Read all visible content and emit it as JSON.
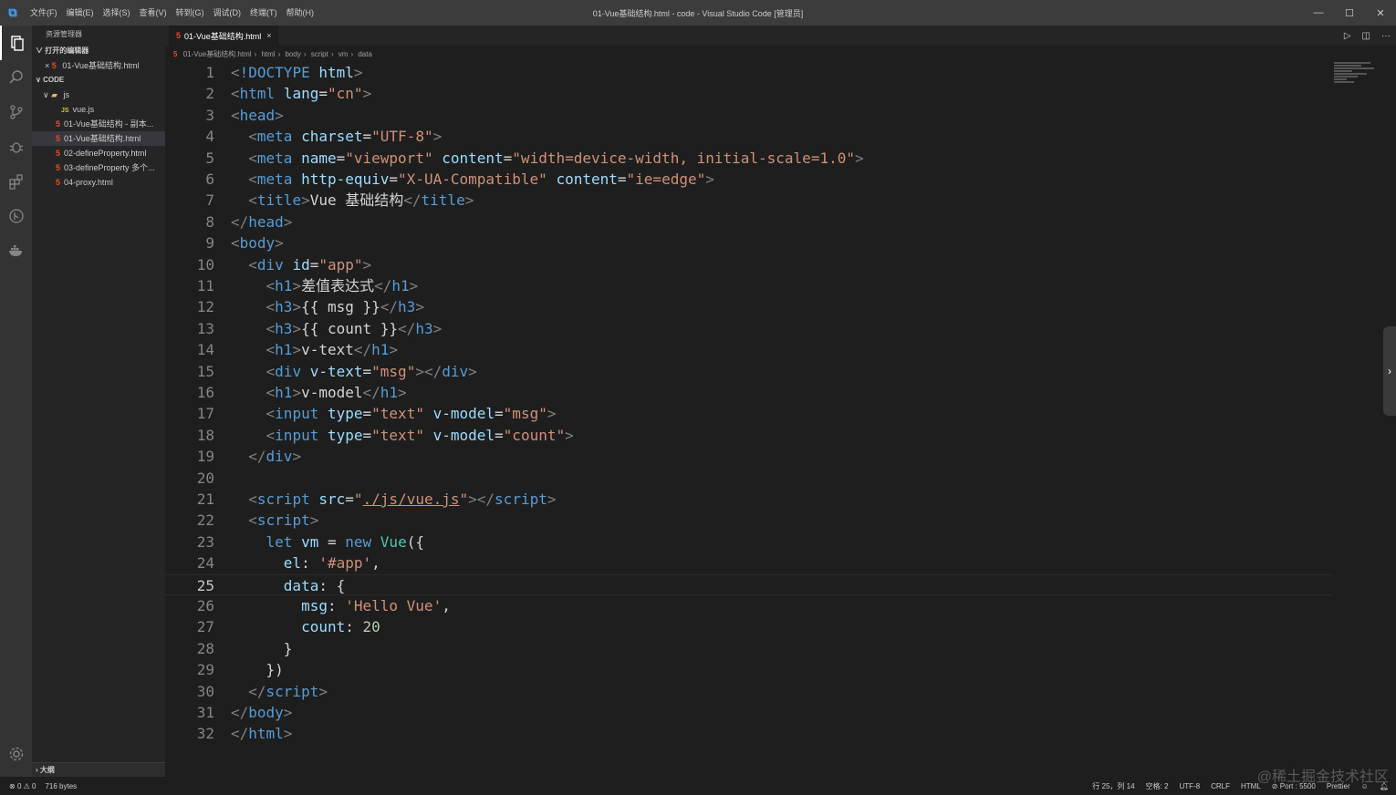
{
  "titlebar": {
    "menu": [
      "文件(F)",
      "编辑(E)",
      "选择(S)",
      "查看(V)",
      "转到(G)",
      "调试(D)",
      "终端(T)",
      "帮助(H)"
    ],
    "title": "01-Vue基础结构.html - code - Visual Studio Code [管理员]"
  },
  "sidebar": {
    "title": "资源管理器",
    "open_editors_label": "打开的编辑器",
    "open_editor_file": "01-Vue基础结构.html",
    "workspace_label": "CODE",
    "folder": "js",
    "files": [
      {
        "name": "vue.js",
        "type": "js",
        "indent": 2
      },
      {
        "name": "01-Vue基础结构 - 副本...",
        "type": "html",
        "indent": 1
      },
      {
        "name": "01-Vue基础结构.html",
        "type": "html",
        "indent": 1,
        "selected": true
      },
      {
        "name": "02-defineProperty.html",
        "type": "html",
        "indent": 1
      },
      {
        "name": "03-defineProperty 多个...",
        "type": "html",
        "indent": 1
      },
      {
        "name": "04-proxy.html",
        "type": "html",
        "indent": 1
      }
    ],
    "outline_label": "大纲"
  },
  "tab": {
    "label": "01-Vue基础结构.html",
    "close": "×"
  },
  "breadcrumb": [
    "01-Vue基础结构.html",
    "html",
    "body",
    "script",
    "vm",
    "data"
  ],
  "editor": {
    "current_line": 25,
    "lines": [
      [
        [
          "t-br",
          "<"
        ],
        [
          "t-tag",
          "!DOCTYPE"
        ],
        [
          "t-text",
          " "
        ],
        [
          "t-attr",
          "html"
        ],
        [
          "t-br",
          ">"
        ]
      ],
      [
        [
          "t-br",
          "<"
        ],
        [
          "t-tag",
          "html"
        ],
        [
          "t-text",
          " "
        ],
        [
          "t-attr",
          "lang"
        ],
        [
          "t-text",
          "="
        ],
        [
          "t-str",
          "\"cn\""
        ],
        [
          "t-br",
          ">"
        ]
      ],
      [
        [
          "t-br",
          "<"
        ],
        [
          "t-tag",
          "head"
        ],
        [
          "t-br",
          ">"
        ]
      ],
      [
        [
          "t-text",
          "  "
        ],
        [
          "t-br",
          "<"
        ],
        [
          "t-tag",
          "meta"
        ],
        [
          "t-text",
          " "
        ],
        [
          "t-attr",
          "charset"
        ],
        [
          "t-text",
          "="
        ],
        [
          "t-str",
          "\"UTF-8\""
        ],
        [
          "t-br",
          ">"
        ]
      ],
      [
        [
          "t-text",
          "  "
        ],
        [
          "t-br",
          "<"
        ],
        [
          "t-tag",
          "meta"
        ],
        [
          "t-text",
          " "
        ],
        [
          "t-attr",
          "name"
        ],
        [
          "t-text",
          "="
        ],
        [
          "t-str",
          "\"viewport\""
        ],
        [
          "t-text",
          " "
        ],
        [
          "t-attr",
          "content"
        ],
        [
          "t-text",
          "="
        ],
        [
          "t-str",
          "\"width=device-width, initial-scale=1.0\""
        ],
        [
          "t-br",
          ">"
        ]
      ],
      [
        [
          "t-text",
          "  "
        ],
        [
          "t-br",
          "<"
        ],
        [
          "t-tag",
          "meta"
        ],
        [
          "t-text",
          " "
        ],
        [
          "t-attr",
          "http-equiv"
        ],
        [
          "t-text",
          "="
        ],
        [
          "t-str",
          "\"X-UA-Compatible\""
        ],
        [
          "t-text",
          " "
        ],
        [
          "t-attr",
          "content"
        ],
        [
          "t-text",
          "="
        ],
        [
          "t-str",
          "\"ie=edge\""
        ],
        [
          "t-br",
          ">"
        ]
      ],
      [
        [
          "t-text",
          "  "
        ],
        [
          "t-br",
          "<"
        ],
        [
          "t-tag",
          "title"
        ],
        [
          "t-br",
          ">"
        ],
        [
          "t-text",
          "Vue 基础结构"
        ],
        [
          "t-br",
          "</"
        ],
        [
          "t-tag",
          "title"
        ],
        [
          "t-br",
          ">"
        ]
      ],
      [
        [
          "t-br",
          "</"
        ],
        [
          "t-tag",
          "head"
        ],
        [
          "t-br",
          ">"
        ]
      ],
      [
        [
          "t-br",
          "<"
        ],
        [
          "t-tag",
          "body"
        ],
        [
          "t-br",
          ">"
        ]
      ],
      [
        [
          "t-text",
          "  "
        ],
        [
          "t-br",
          "<"
        ],
        [
          "t-tag",
          "div"
        ],
        [
          "t-text",
          " "
        ],
        [
          "t-attr",
          "id"
        ],
        [
          "t-text",
          "="
        ],
        [
          "t-str",
          "\"app\""
        ],
        [
          "t-br",
          ">"
        ]
      ],
      [
        [
          "t-text",
          "    "
        ],
        [
          "t-br",
          "<"
        ],
        [
          "t-tag",
          "h1"
        ],
        [
          "t-br",
          ">"
        ],
        [
          "t-text",
          "差值表达式"
        ],
        [
          "t-br",
          "</"
        ],
        [
          "t-tag",
          "h1"
        ],
        [
          "t-br",
          ">"
        ]
      ],
      [
        [
          "t-text",
          "    "
        ],
        [
          "t-br",
          "<"
        ],
        [
          "t-tag",
          "h3"
        ],
        [
          "t-br",
          ">"
        ],
        [
          "t-text",
          "{{ msg }}"
        ],
        [
          "t-br",
          "</"
        ],
        [
          "t-tag",
          "h3"
        ],
        [
          "t-br",
          ">"
        ]
      ],
      [
        [
          "t-text",
          "    "
        ],
        [
          "t-br",
          "<"
        ],
        [
          "t-tag",
          "h3"
        ],
        [
          "t-br",
          ">"
        ],
        [
          "t-text",
          "{{ count }}"
        ],
        [
          "t-br",
          "</"
        ],
        [
          "t-tag",
          "h3"
        ],
        [
          "t-br",
          ">"
        ]
      ],
      [
        [
          "t-text",
          "    "
        ],
        [
          "t-br",
          "<"
        ],
        [
          "t-tag",
          "h1"
        ],
        [
          "t-br",
          ">"
        ],
        [
          "t-text",
          "v-text"
        ],
        [
          "t-br",
          "</"
        ],
        [
          "t-tag",
          "h1"
        ],
        [
          "t-br",
          ">"
        ]
      ],
      [
        [
          "t-text",
          "    "
        ],
        [
          "t-br",
          "<"
        ],
        [
          "t-tag",
          "div"
        ],
        [
          "t-text",
          " "
        ],
        [
          "t-attr",
          "v-text"
        ],
        [
          "t-text",
          "="
        ],
        [
          "t-str",
          "\"msg\""
        ],
        [
          "t-br",
          "></"
        ],
        [
          "t-tag",
          "div"
        ],
        [
          "t-br",
          ">"
        ]
      ],
      [
        [
          "t-text",
          "    "
        ],
        [
          "t-br",
          "<"
        ],
        [
          "t-tag",
          "h1"
        ],
        [
          "t-br",
          ">"
        ],
        [
          "t-text",
          "v-model"
        ],
        [
          "t-br",
          "</"
        ],
        [
          "t-tag",
          "h1"
        ],
        [
          "t-br",
          ">"
        ]
      ],
      [
        [
          "t-text",
          "    "
        ],
        [
          "t-br",
          "<"
        ],
        [
          "t-tag",
          "input"
        ],
        [
          "t-text",
          " "
        ],
        [
          "t-attr",
          "type"
        ],
        [
          "t-text",
          "="
        ],
        [
          "t-str",
          "\"text\""
        ],
        [
          "t-text",
          " "
        ],
        [
          "t-attr",
          "v-model"
        ],
        [
          "t-text",
          "="
        ],
        [
          "t-str",
          "\"msg\""
        ],
        [
          "t-br",
          ">"
        ]
      ],
      [
        [
          "t-text",
          "    "
        ],
        [
          "t-br",
          "<"
        ],
        [
          "t-tag",
          "input"
        ],
        [
          "t-text",
          " "
        ],
        [
          "t-attr",
          "type"
        ],
        [
          "t-text",
          "="
        ],
        [
          "t-str",
          "\"text\""
        ],
        [
          "t-text",
          " "
        ],
        [
          "t-attr",
          "v-model"
        ],
        [
          "t-text",
          "="
        ],
        [
          "t-str",
          "\"count\""
        ],
        [
          "t-br",
          ">"
        ]
      ],
      [
        [
          "t-text",
          "  "
        ],
        [
          "t-br",
          "</"
        ],
        [
          "t-tag",
          "div"
        ],
        [
          "t-br",
          ">"
        ]
      ],
      [],
      [
        [
          "t-text",
          "  "
        ],
        [
          "t-br",
          "<"
        ],
        [
          "t-tag",
          "script"
        ],
        [
          "t-text",
          " "
        ],
        [
          "t-attr",
          "src"
        ],
        [
          "t-text",
          "="
        ],
        [
          "t-str",
          "\""
        ],
        [
          "t-str t-u",
          "./js/vue.js"
        ],
        [
          "t-str",
          "\""
        ],
        [
          "t-br",
          "></"
        ],
        [
          "t-tag",
          "script"
        ],
        [
          "t-br",
          ">"
        ]
      ],
      [
        [
          "t-text",
          "  "
        ],
        [
          "t-br",
          "<"
        ],
        [
          "t-tag",
          "script"
        ],
        [
          "t-br",
          ">"
        ]
      ],
      [
        [
          "t-text",
          "    "
        ],
        [
          "t-kw",
          "let"
        ],
        [
          "t-text",
          " "
        ],
        [
          "t-var",
          "vm"
        ],
        [
          "t-text",
          " = "
        ],
        [
          "t-kw",
          "new"
        ],
        [
          "t-text",
          " "
        ],
        [
          "t-cls",
          "Vue"
        ],
        [
          "t-text",
          "({"
        ]
      ],
      [
        [
          "t-text",
          "      "
        ],
        [
          "t-var",
          "el"
        ],
        [
          "t-text",
          ": "
        ],
        [
          "t-str",
          "'#app'"
        ],
        [
          "t-text",
          ","
        ]
      ],
      [
        [
          "t-text",
          "      "
        ],
        [
          "t-var",
          "data"
        ],
        [
          "t-text",
          ": {"
        ]
      ],
      [
        [
          "t-text",
          "        "
        ],
        [
          "t-var",
          "msg"
        ],
        [
          "t-text",
          ": "
        ],
        [
          "t-str",
          "'Hello Vue'"
        ],
        [
          "t-text",
          ","
        ]
      ],
      [
        [
          "t-text",
          "        "
        ],
        [
          "t-var",
          "count"
        ],
        [
          "t-text",
          ": "
        ],
        [
          "t-num",
          "20"
        ]
      ],
      [
        [
          "t-text",
          "      }"
        ]
      ],
      [
        [
          "t-text",
          "    })"
        ]
      ],
      [
        [
          "t-text",
          "  "
        ],
        [
          "t-br",
          "</"
        ],
        [
          "t-tag",
          "script"
        ],
        [
          "t-br",
          ">"
        ]
      ],
      [
        [
          "t-br",
          "</"
        ],
        [
          "t-tag",
          "body"
        ],
        [
          "t-br",
          ">"
        ]
      ],
      [
        [
          "t-br",
          "</"
        ],
        [
          "t-tag",
          "html"
        ],
        [
          "t-br",
          ">"
        ]
      ]
    ]
  },
  "statusbar": {
    "errors": "0",
    "warnings": "0",
    "size": "716 bytes",
    "position": "行 25，列 14",
    "spaces": "空格: 2",
    "encoding": "UTF-8",
    "eol": "CRLF",
    "language": "HTML",
    "port": "Port : 5500",
    "formatter": "Prettier"
  },
  "watermark": "@稀土掘金技术社区"
}
